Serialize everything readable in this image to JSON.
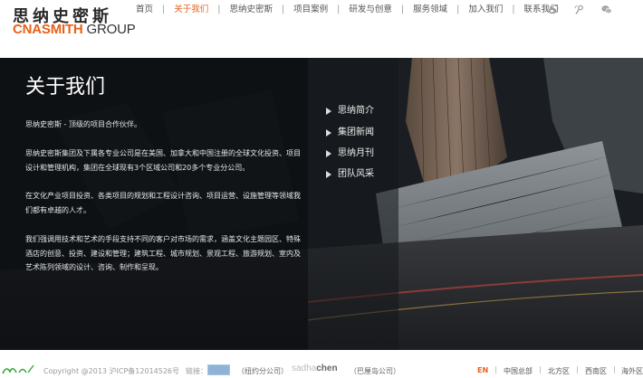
{
  "header": {
    "logo": {
      "cn": "思纳史密斯",
      "en_brand": "CNASMITH",
      "en_group": "GROUP"
    },
    "nav": [
      {
        "label": "首页",
        "active": false
      },
      {
        "label": "关于我们",
        "active": true
      },
      {
        "label": "思纳史密斯",
        "active": false
      },
      {
        "label": "项目案例",
        "active": false
      },
      {
        "label": "研发与创意",
        "active": false
      },
      {
        "label": "服务领域",
        "active": false
      },
      {
        "label": "加入我们",
        "active": false
      },
      {
        "label": "联系我们",
        "active": false
      }
    ],
    "separator": "|",
    "social_icons": [
      "weibo-icon",
      "tencent-weibo-icon",
      "wechat-icon"
    ]
  },
  "main": {
    "title": "关于我们",
    "paragraphs": [
      "思纳史密斯 - 顶级的项目合作伙伴。",
      "思纳史密斯集团及下属各专业公司是在美国、加拿大和中国注册的全球文化投资、项目设计和管理机构，集团在全球现有3个区域公司和20多个专业分公司。",
      "在文化产业项目投资、各类项目的规划和工程设计咨询、项目运营、设施管理等领域我们都有卓越的人才。",
      "我们强调用技术和艺术的手段支持不同的客户对市场的需求，涵盖文化主题园区、特殊酒店的创意、投资、建设和管理；建筑工程、城市规划、景观工程、旅游规划、室内及艺术陈列领域的设计、咨询、制作和呈现。"
    ],
    "side_menu": [
      {
        "label": "思纳简介"
      },
      {
        "label": "集团新闻"
      },
      {
        "label": "思纳月刊"
      },
      {
        "label": "团队风采"
      }
    ]
  },
  "footer": {
    "copyright": "Copyright @2013 沪ICP备12014526号",
    "links_label": "链接：",
    "newyork": "（纽约分公司）",
    "sadha_light": "sadha",
    "sadha_bold": "chen",
    "paris": "（巴厘岛公司）",
    "lang": "EN",
    "regions": [
      "中国总部",
      "北方区",
      "西南区",
      "海外区"
    ]
  },
  "colors": {
    "accent": "#e9601a",
    "panel": "#0c0e11"
  }
}
